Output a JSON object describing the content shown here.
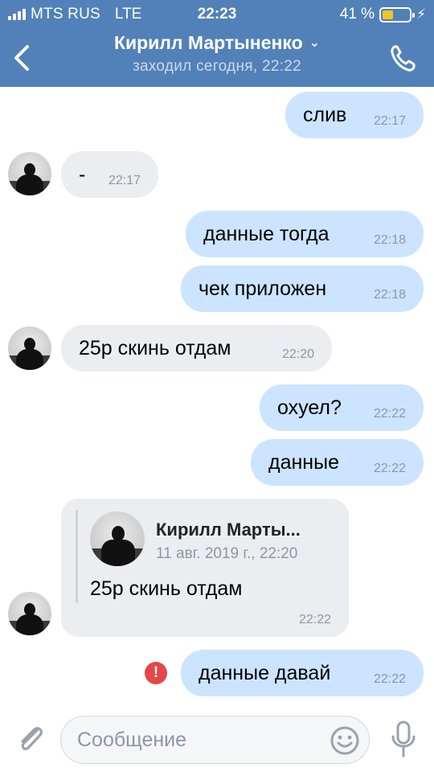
{
  "status_bar": {
    "carrier": "MTS RUS",
    "network": "LTE",
    "time": "22:23",
    "battery_percent": "41 %",
    "battery_level": 0.41
  },
  "header": {
    "title": "Кирилл Мартыненко",
    "subtitle": "заходил сегодня, 22:22"
  },
  "messages": [
    {
      "text": "слив",
      "time": "22:17"
    },
    {
      "text": "-",
      "time": "22:17"
    },
    {
      "text": "данные тогда",
      "time": "22:18"
    },
    {
      "text": "чек приложен",
      "time": "22:18"
    },
    {
      "text": "25р скинь отдам",
      "time": "22:20"
    },
    {
      "text": "охуел?",
      "time": "22:22"
    },
    {
      "text": "данные",
      "time": "22:22"
    },
    {
      "forwarded": {
        "name": "Кирилл Марты...",
        "date": "11 авг. 2019 г., 22:20",
        "text": "25р скинь отдам"
      },
      "time": "22:22"
    },
    {
      "text": "данные давай",
      "time": "22:22"
    }
  ],
  "composer": {
    "placeholder": "Сообщение"
  },
  "colors": {
    "header_bg": "#5181b8",
    "outgoing_bubble": "#cce4ff",
    "incoming_bubble": "#ebedf0",
    "error": "#e64646"
  }
}
